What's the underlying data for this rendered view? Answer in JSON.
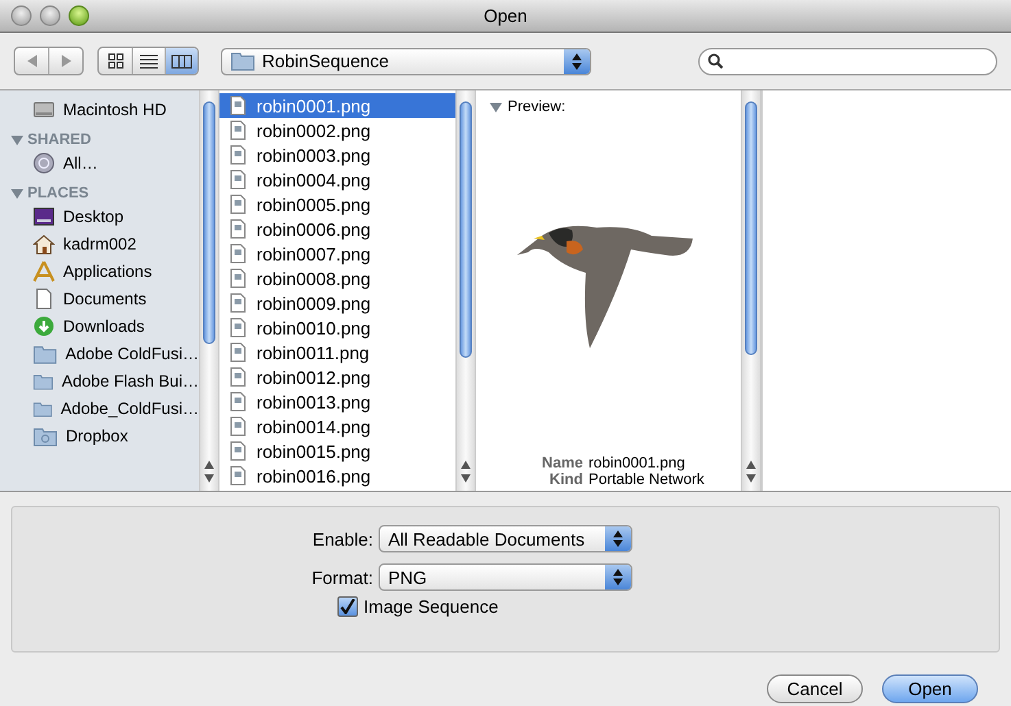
{
  "window": {
    "title": "Open"
  },
  "toolbar": {
    "view_modes": [
      {
        "kind": "icons",
        "selected": false
      },
      {
        "kind": "list",
        "selected": false
      },
      {
        "kind": "columns",
        "selected": true
      }
    ],
    "location": "RobinSequence"
  },
  "sidebar": {
    "sections": [
      {
        "items": [
          {
            "kind": "disk",
            "label": "Macintosh HD"
          }
        ]
      },
      {
        "title": "SHARED",
        "items": [
          {
            "kind": "network",
            "label": "All…"
          }
        ]
      },
      {
        "title": "PLACES",
        "items": [
          {
            "kind": "desktop",
            "label": "Desktop"
          },
          {
            "kind": "home",
            "label": "kadrm002"
          },
          {
            "kind": "apps",
            "label": "Applications"
          },
          {
            "kind": "document",
            "label": "Documents"
          },
          {
            "kind": "download",
            "label": "Downloads"
          },
          {
            "kind": "folder",
            "label": "Adobe ColdFusi…"
          },
          {
            "kind": "folder",
            "label": "Adobe Flash Bui…"
          },
          {
            "kind": "folder",
            "label": "Adobe_ColdFusi…"
          },
          {
            "kind": "dropbox",
            "label": "Dropbox"
          }
        ]
      }
    ]
  },
  "files": [
    {
      "name": "robin0001.png",
      "selected": true
    },
    {
      "name": "robin0002.png",
      "selected": false
    },
    {
      "name": "robin0003.png",
      "selected": false
    },
    {
      "name": "robin0004.png",
      "selected": false
    },
    {
      "name": "robin0005.png",
      "selected": false
    },
    {
      "name": "robin0006.png",
      "selected": false
    },
    {
      "name": "robin0007.png",
      "selected": false
    },
    {
      "name": "robin0008.png",
      "selected": false
    },
    {
      "name": "robin0009.png",
      "selected": false
    },
    {
      "name": "robin0010.png",
      "selected": false
    },
    {
      "name": "robin0011.png",
      "selected": false
    },
    {
      "name": "robin0012.png",
      "selected": false
    },
    {
      "name": "robin0013.png",
      "selected": false
    },
    {
      "name": "robin0014.png",
      "selected": false
    },
    {
      "name": "robin0015.png",
      "selected": false
    },
    {
      "name": "robin0016.png",
      "selected": false
    }
  ],
  "preview": {
    "title": "Preview:",
    "fields": [
      {
        "label": "Name",
        "value": "robin0001.png"
      },
      {
        "label": "Kind",
        "value": "Portable Network"
      }
    ]
  },
  "options": {
    "enable": {
      "label": "Enable:",
      "value": "All Readable Documents"
    },
    "format": {
      "label": "Format:",
      "value": "PNG"
    },
    "image_sequence": {
      "label": "Image Sequence",
      "checked": true
    }
  },
  "buttons": [
    {
      "label": "Cancel",
      "kind": "normal"
    },
    {
      "label": "Open",
      "kind": "default"
    }
  ]
}
